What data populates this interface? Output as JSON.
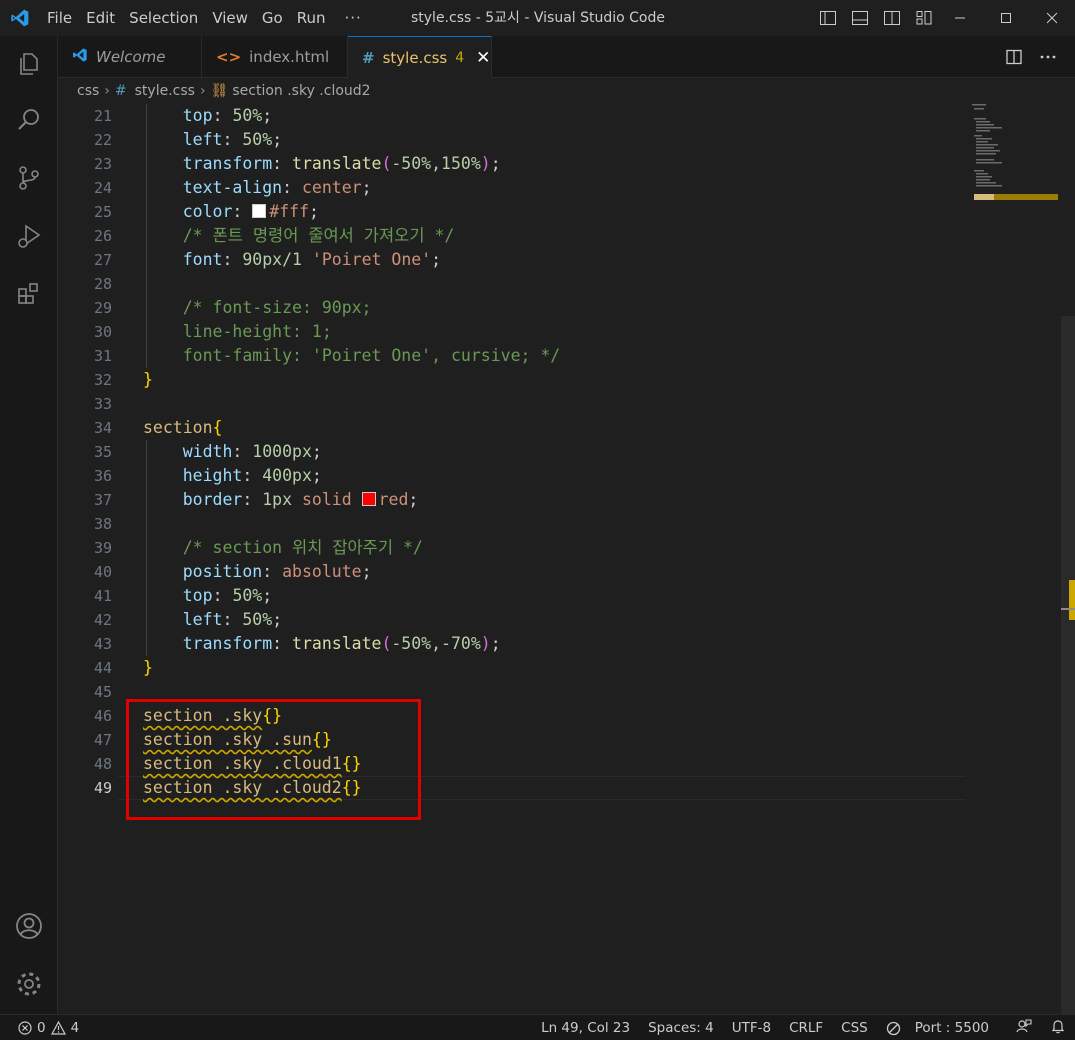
{
  "titlebar": {
    "menu": [
      "File",
      "Edit",
      "Selection",
      "View",
      "Go",
      "Run"
    ],
    "more": "···",
    "title": "style.css - 5교시 - Visual Studio Code"
  },
  "tabs": [
    {
      "label": "Welcome",
      "icon": "vscode-icon"
    },
    {
      "label": "index.html",
      "icon": "html-icon"
    },
    {
      "label": "style.css",
      "icon": "css-hash-icon",
      "badge": "4",
      "active": true
    }
  ],
  "breadcrumb": {
    "folder": "css",
    "file": "style.css",
    "symbol": "section .sky .cloud2"
  },
  "editor": {
    "line_numbers": [
      "21",
      "22",
      "23",
      "24",
      "25",
      "26",
      "27",
      "28",
      "29",
      "30",
      "31",
      "32",
      "33",
      "34",
      "35",
      "36",
      "37",
      "38",
      "39",
      "40",
      "41",
      "42",
      "43",
      "44",
      "45",
      "46",
      "47",
      "48",
      "49"
    ],
    "current_line": "49"
  },
  "code": {
    "l21": {
      "prop": "top",
      "val": "50%"
    },
    "l22": {
      "prop": "left",
      "val": "50%"
    },
    "l23": {
      "prop": "transform",
      "fn": "translate",
      "args": "-50%,150%"
    },
    "l24": {
      "prop": "text-align",
      "val": "center"
    },
    "l25": {
      "prop": "color",
      "val": "#fff",
      "swatch": "#ffffff"
    },
    "l26": {
      "comment": "/* 폰트 명령어 줄여서 가져오기 */"
    },
    "l27": {
      "prop": "font",
      "val": "90px/1",
      "str": "'Poiret One'"
    },
    "l29": {
      "comment": "/* font-size: 90px;"
    },
    "l30": {
      "comment": "line-height: 1;"
    },
    "l31": {
      "comment": "font-family: 'Poiret One', cursive; */"
    },
    "l32": {
      "brace": "}"
    },
    "l34": {
      "selector": "section",
      "brace": "{"
    },
    "l35": {
      "prop": "width",
      "val": "1000px"
    },
    "l36": {
      "prop": "height",
      "val": "400px"
    },
    "l37": {
      "prop": "border",
      "val": "1px",
      "kw": "solid",
      "color": "red",
      "swatch": "#ff0000"
    },
    "l39": {
      "comment": "/* section 위치 잡아주기 */"
    },
    "l40": {
      "prop": "position",
      "val": "absolute"
    },
    "l41": {
      "prop": "top",
      "val": "50%"
    },
    "l42": {
      "prop": "left",
      "val": "50%"
    },
    "l43": {
      "prop": "transform",
      "fn": "translate",
      "args": "-50%,-70%"
    },
    "l44": {
      "brace": "}"
    },
    "l46": {
      "selector": "section .sky",
      "braces": "{}"
    },
    "l47": {
      "selector": "section .sky .sun",
      "braces": "{}"
    },
    "l48": {
      "selector": "section .sky .cloud1",
      "braces": "{}"
    },
    "l49": {
      "selector": "section .sky .cloud2",
      "braces": "{}"
    }
  },
  "statusbar": {
    "errors": "0",
    "warnings": "4",
    "position": "Ln 49, Col 23",
    "spaces": "Spaces: 4",
    "encoding": "UTF-8",
    "eol": "CRLF",
    "language": "CSS",
    "port": "Port : 5500"
  },
  "colors": {
    "accent": "#0078d4",
    "highlight_box": "#e00000",
    "warning": "#cca700"
  }
}
